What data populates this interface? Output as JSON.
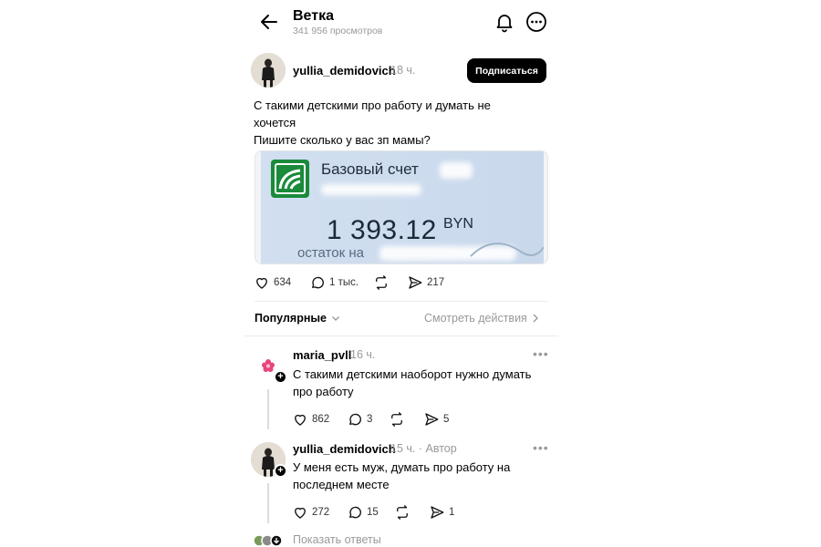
{
  "header": {
    "title": "Ветка",
    "views": "341 956 просмотров"
  },
  "post": {
    "username": "yullia_demidovich",
    "time": "18 ч.",
    "subscribe_label": "Подписаться",
    "text_lines": [
      "С такими детскими про работу и думать не",
      "хочется",
      "Пишите сколько у вас зп мамы?"
    ],
    "image": {
      "account_title": "Базовый счет",
      "amount": "1 393.12",
      "currency": "BYN",
      "balance_label": "остаток на"
    },
    "actions": {
      "likes": "634",
      "comments": "1 тыс.",
      "shares": "217"
    }
  },
  "sort": {
    "label": "Популярные",
    "activity_label": "Смотреть действия"
  },
  "comments": [
    {
      "username": "maria_pvll",
      "time": "16 ч.",
      "text_lines": [
        "С такими детскими  наоборот нужно думать",
        "про работу"
      ],
      "likes": "862",
      "comments": "3",
      "shares": "5"
    },
    {
      "username": "yullia_demidovich",
      "time": "15 ч.",
      "author_tag": "· Автор",
      "text_lines": [
        "У меня есть муж, думать про работу на",
        "последнем месте"
      ],
      "likes": "272",
      "comments": "15",
      "shares": "1"
    }
  ],
  "show_replies_label": "Показать ответы",
  "icons": {
    "back": "arrow-left-icon",
    "bell": "bell-icon",
    "more": "more-circle-icon",
    "like": "heart-icon",
    "comment": "comment-bubble-icon",
    "repost": "repost-icon",
    "share": "send-icon",
    "chevron": "chevron-icon"
  },
  "colors": {
    "subscribe_bg": "#000000",
    "bank_green": "#1a8a3b",
    "card_bg": "#d1dff0",
    "muted_text": "#999999"
  }
}
